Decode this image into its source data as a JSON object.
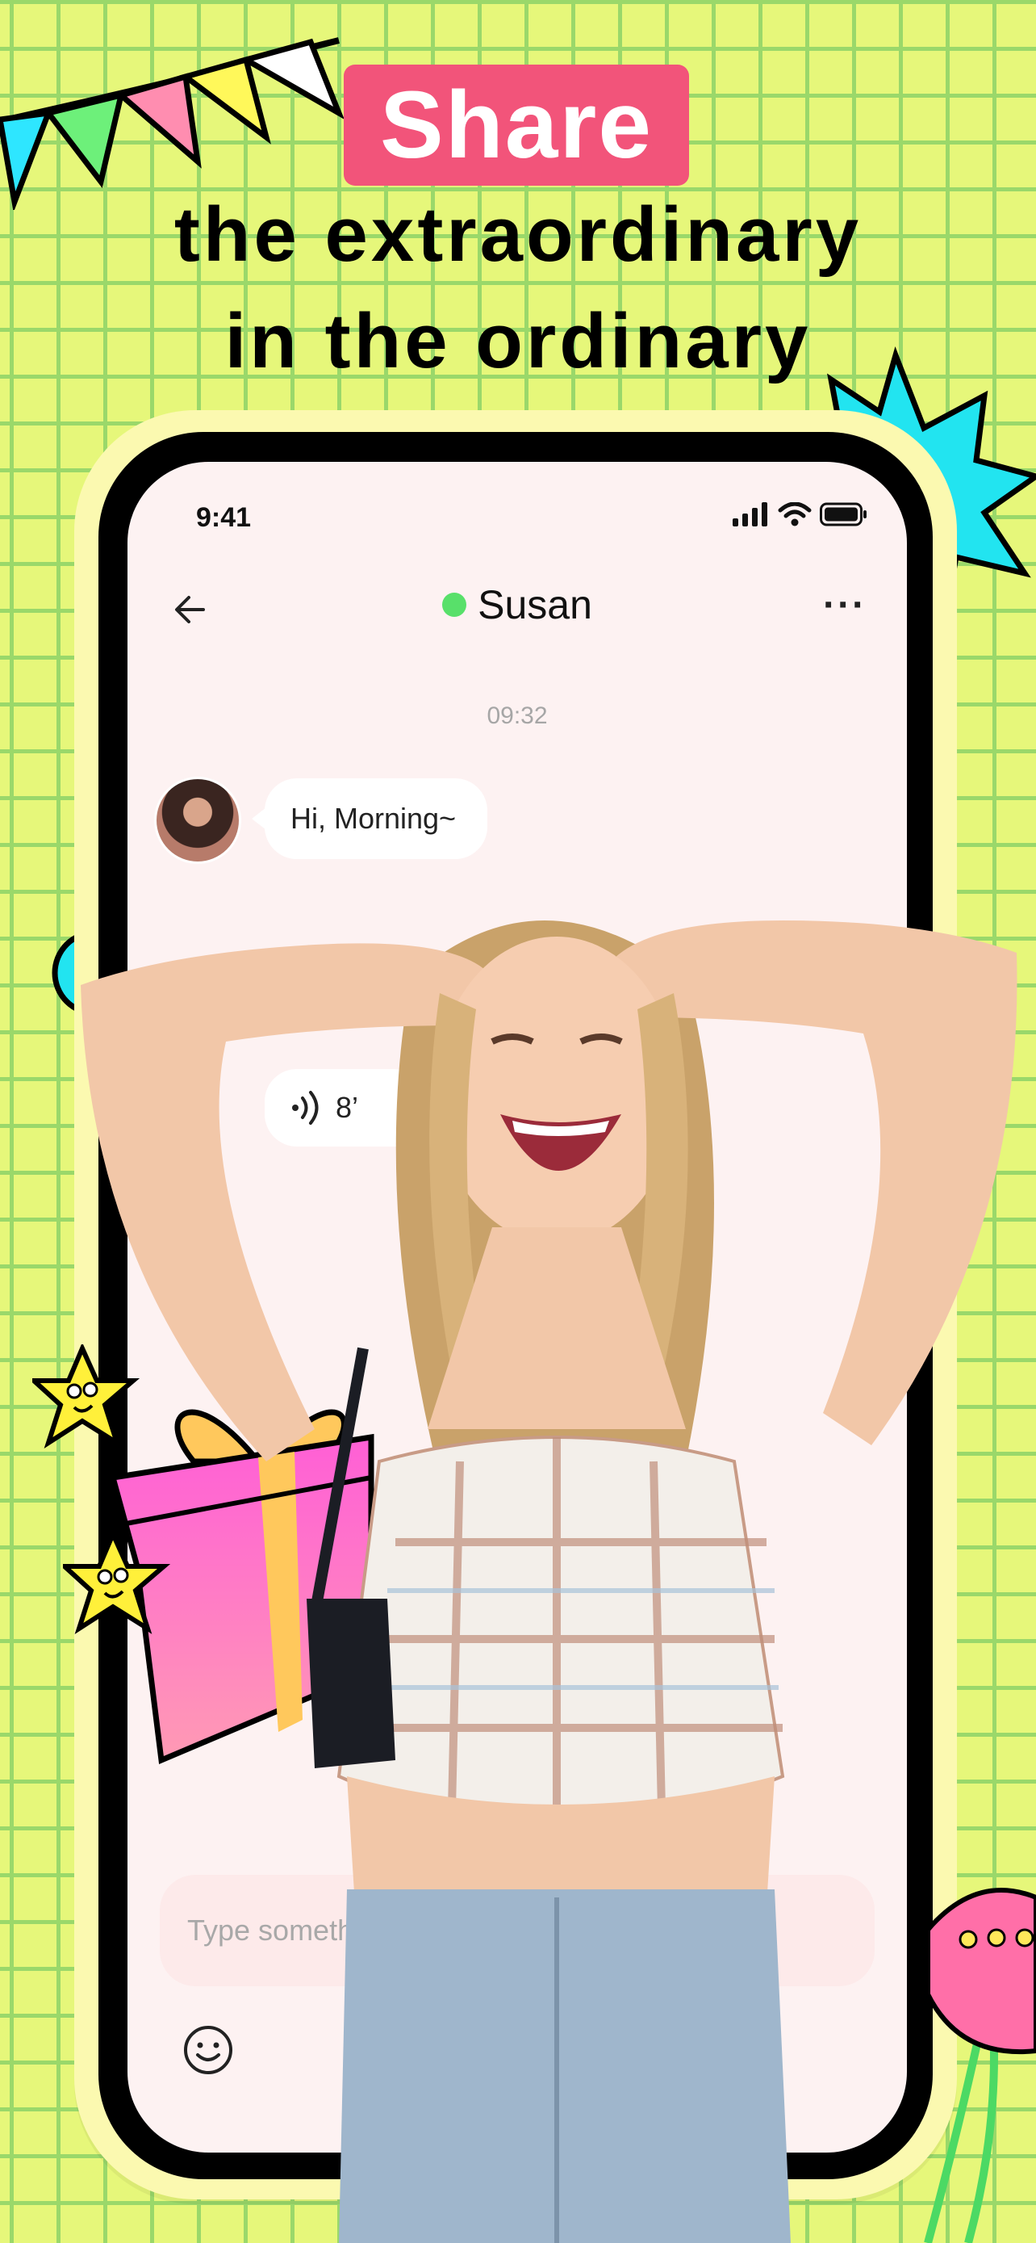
{
  "headline": {
    "badge": "Share",
    "line1": "the extraordinary",
    "line2": "in the ordinary"
  },
  "colors": {
    "background": "#e6f77a",
    "grid": "#9ad86a",
    "badge": "#f2547a",
    "online": "#58e06a"
  },
  "status_bar": {
    "time": "9:41",
    "icons": [
      "signal-icon",
      "wifi-icon",
      "battery-icon"
    ]
  },
  "chat": {
    "back_icon": "arrow-left-icon",
    "contact_name": "Susan",
    "more_icon": "more-dots-icon",
    "timestamp": "09:32",
    "messages": [
      {
        "type": "text",
        "text": "Hi, Morning~"
      },
      {
        "type": "voice",
        "duration": "8’"
      }
    ]
  },
  "composer": {
    "placeholder": "Type something",
    "emoji_icon": "smiley-icon"
  }
}
